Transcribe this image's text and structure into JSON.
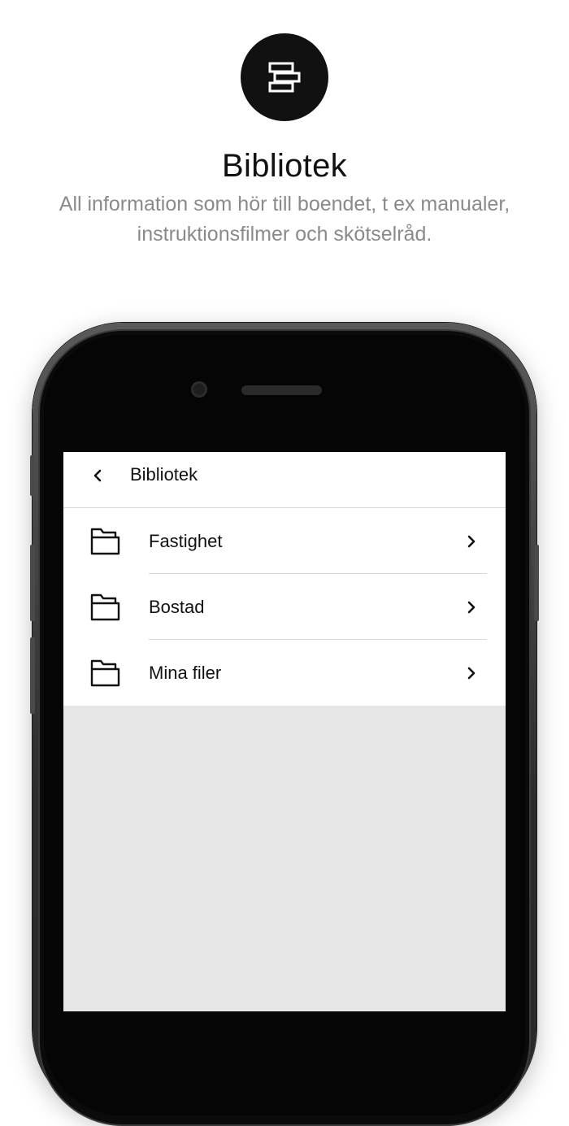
{
  "hero": {
    "icon": "library-books-icon",
    "title": "Bibliotek",
    "subtitle": "All information som hör till boendet, t ex manualer, instruktionsfilmer och skötselråd."
  },
  "screen": {
    "nav": {
      "back_icon": "chevron-left-icon",
      "title": "Bibliotek"
    },
    "items": [
      {
        "label": "Fastighet",
        "icon": "folder-icon",
        "trailing_icon": "chevron-right-icon"
      },
      {
        "label": "Bostad",
        "icon": "folder-icon",
        "trailing_icon": "chevron-right-icon"
      },
      {
        "label": "Mina filer",
        "icon": "folder-icon",
        "trailing_icon": "chevron-right-icon"
      }
    ]
  },
  "colors": {
    "hero_circle": "#111111",
    "subtitle_text": "#8a8a8a",
    "screen_background": "#e6e6e6",
    "divider": "#d8d8d8"
  }
}
